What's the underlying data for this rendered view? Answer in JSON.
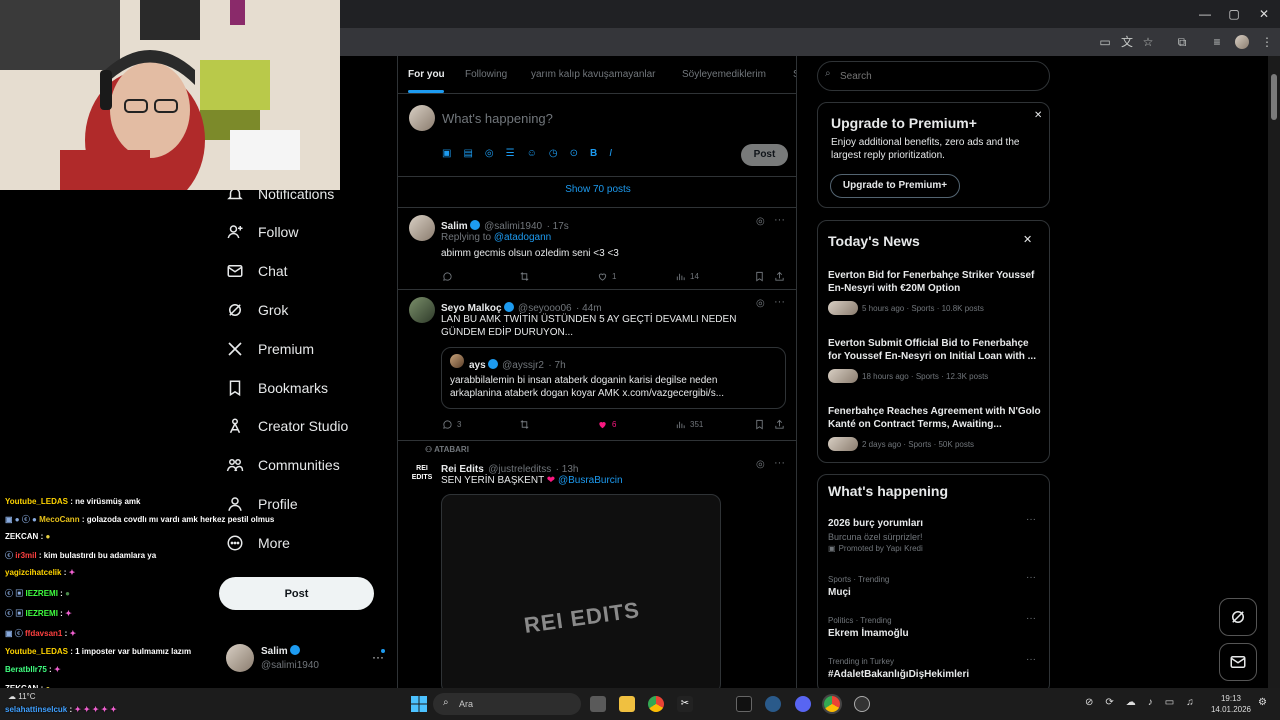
{
  "feed": {
    "tabs": [
      "For you",
      "Following",
      "yarım kalıp kavuşamayanlar",
      "Söyleyemediklerim",
      "S"
    ],
    "composer": {
      "placeholder": "What's happening?",
      "post_label": "Post"
    },
    "show_posts": "Show 70 posts",
    "tweets": [
      {
        "name": "Salim",
        "handle": "@salimi1940",
        "time": "· 17s",
        "replying_prefix": "Replying to",
        "replying_to": "@atadogann",
        "text": "abimm gecmis olsun ozledim seni <3 <3",
        "likes": "1",
        "views": "14"
      },
      {
        "name": "Seyo Malkoç",
        "handle": "@seyooo06",
        "time": "· 44m",
        "text": "LAN BU AMK TWİTİN ÜSTÜNDEN 5 AY GEÇTİ DEVAMLI NEDEN GÜNDEM EDİP DURUYON...",
        "quote": {
          "name": "ays",
          "handle": "@ayssjr2",
          "time": "· 7h",
          "text": "yarabbilalemin bi insan ataberk doganin karisi degilse neden arkaplanina ataberk dogan koyar AMK x.com/vazgecergibi/s..."
        },
        "replies": "3",
        "likes": "6",
        "views": "351"
      },
      {
        "social_context": "ATABARI",
        "name": "Rei Edits",
        "handle": "@justreleditss",
        "time": "· 13h",
        "text": "SEN YERİN BAŞKENT",
        "mention": "@BusraBurcin",
        "media_logo": "REI EDITS",
        "avatar_text": "REI EDITS"
      }
    ]
  },
  "nav": {
    "items": [
      "Notifications",
      "Follow",
      "Chat",
      "Grok",
      "Premium",
      "Bookmarks",
      "Creator Studio",
      "Communities",
      "Profile",
      "More"
    ],
    "post_label": "Post",
    "account": {
      "name": "Salim",
      "handle": "@salimi1940"
    }
  },
  "sidebar": {
    "search_placeholder": "Search",
    "premium": {
      "title": "Upgrade to Premium+",
      "body": "Enjoy additional benefits, zero ads and the largest reply prioritization.",
      "button": "Upgrade to Premium+"
    },
    "news": {
      "title": "Today's News",
      "items": [
        {
          "title": "Everton Bid for Fenerbahçe Striker Youssef En-Nesyri with €20M Option",
          "meta": "5 hours ago · Sports · 10.8K posts"
        },
        {
          "title": "Everton Submit Official Bid to Fenerbahçe for Youssef En-Nesyri on Initial Loan with ...",
          "meta": "18 hours ago · Sports · 12.3K posts"
        },
        {
          "title": "Fenerbahçe Reaches Agreement with N'Golo Kanté on Contract Terms, Awaiting...",
          "meta": "2 days ago · Sports · 50K posts"
        }
      ]
    },
    "happening": {
      "title": "What's happening",
      "items": [
        {
          "title": "2026 burç yorumları",
          "sub": "Burcuna özel sürprizler!",
          "promo": "Promoted by Yapı Kredi"
        },
        {
          "context": "Sports · Trending",
          "title": "Muçi"
        },
        {
          "context": "Politics · Trending",
          "title": "Ekrem İmamoğlu"
        },
        {
          "context": "Trending in Turkey",
          "title": "#AdaletBakanlığıDişHekimleri"
        }
      ]
    }
  },
  "chat": [
    {
      "user": "Youtube_LEDAS",
      "msg": ": ne virüsmüş amk",
      "color": "#ffd400"
    },
    {
      "user": "MecoCann",
      "msg": ": golazoda covdlı mı vardı amk herkez pestil olmus",
      "color": "#e8c21a"
    },
    {
      "user": "ZEKCAN",
      "msg": ":",
      "color": "#ffffff"
    },
    {
      "user": "ir3mil",
      "msg": ": kim bulastırdı bu adamlara ya",
      "color": "#ff4040"
    },
    {
      "user": "yagizcihatcelik",
      "msg": ":",
      "color": "#ffd400"
    },
    {
      "user": "IEZREMI",
      "msg": ":",
      "color": "#40ff40"
    },
    {
      "user": "IEZREMI",
      "msg": ":",
      "color": "#40ff40"
    },
    {
      "user": "ffdavsan1",
      "msg": ":",
      "color": "#ff4040"
    },
    {
      "user": "Youtube_LEDAS",
      "msg": ": 1 imposter var bulmamız lazım",
      "color": "#ffd400"
    },
    {
      "user": "Beratbllr75",
      "msg": ":",
      "color": "#40ff80"
    },
    {
      "user": "ZEKCAN",
      "msg": ":",
      "color": "#ffffff"
    },
    {
      "user": "selahattinselcuk",
      "msg": ":",
      "color": "#40a0ff"
    }
  ],
  "taskbar": {
    "search_placeholder": "Ara",
    "weather": "11°C",
    "time": "19:13",
    "date": "14.01.2026"
  },
  "colors": {
    "accent": "#1d9bf0",
    "like": "#f91880",
    "bg": "#000000",
    "border": "#2f3336"
  }
}
